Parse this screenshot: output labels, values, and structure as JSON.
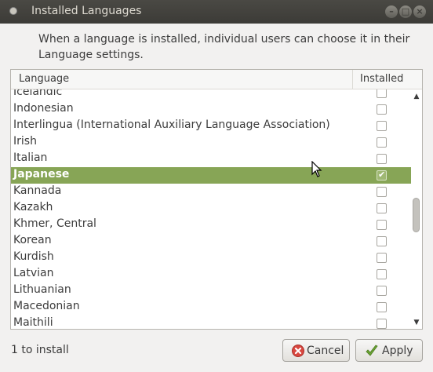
{
  "window": {
    "title": "Installed Languages",
    "controls": [
      "minimize",
      "maximize",
      "close"
    ]
  },
  "intro_text": "When a language is installed, individual users can choose it in their Language settings.",
  "table": {
    "columns": [
      "Language",
      "Installed"
    ],
    "rows": [
      {
        "name": "Icelandic",
        "installed": false
      },
      {
        "name": "Indonesian",
        "installed": false
      },
      {
        "name": "Interlingua (International Auxiliary Language Association)",
        "installed": false
      },
      {
        "name": "Irish",
        "installed": false
      },
      {
        "name": "Italian",
        "installed": false
      },
      {
        "name": "Japanese",
        "installed": true,
        "selected": true
      },
      {
        "name": "Kannada",
        "installed": false
      },
      {
        "name": "Kazakh",
        "installed": false
      },
      {
        "name": "Khmer, Central",
        "installed": false
      },
      {
        "name": "Korean",
        "installed": false
      },
      {
        "name": "Kurdish",
        "installed": false
      },
      {
        "name": "Latvian",
        "installed": false
      },
      {
        "name": "Lithuanian",
        "installed": false
      },
      {
        "name": "Macedonian",
        "installed": false
      },
      {
        "name": "Maithili",
        "installed": false
      }
    ]
  },
  "status_text": "1 to install",
  "buttons": {
    "cancel": {
      "label": "Cancel",
      "icon": "cancel-icon"
    },
    "apply": {
      "label": "Apply",
      "icon": "checkmark-icon"
    }
  },
  "colors": {
    "selection": "#87a556",
    "titlebar": "#3c3b37",
    "window_bg": "#f2f1f0"
  }
}
